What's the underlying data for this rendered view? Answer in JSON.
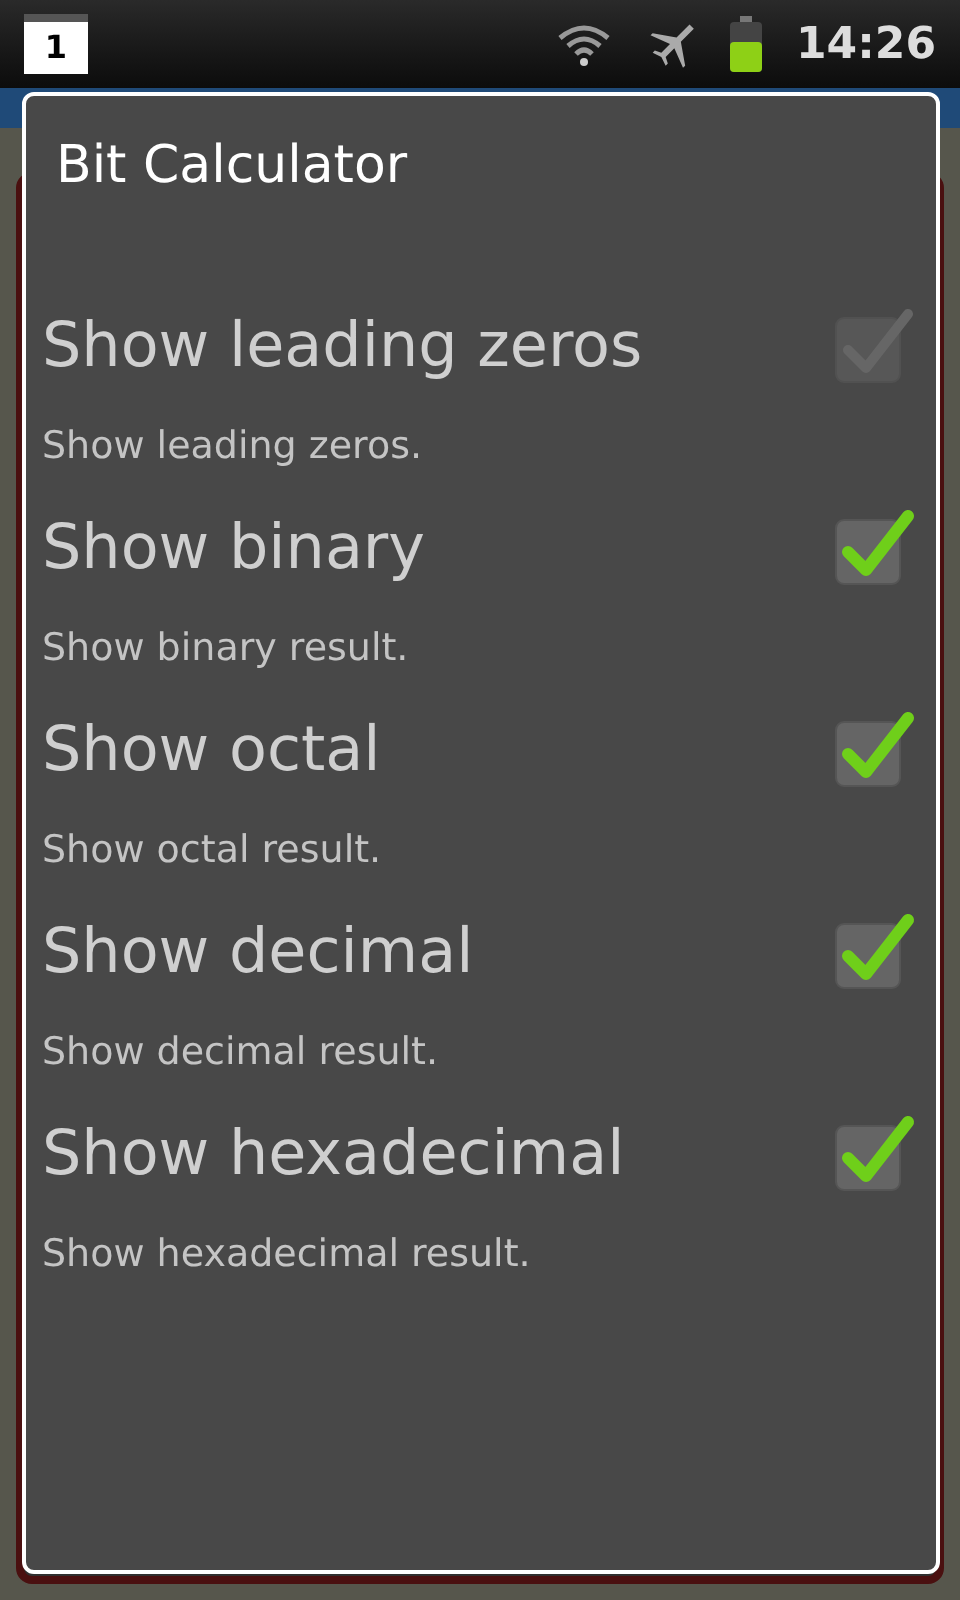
{
  "status_bar": {
    "notification": "1",
    "time": "14:26"
  },
  "dialog": {
    "title": "Bit Calculator",
    "items": [
      {
        "title": "Show leading zeros",
        "summary": "Show leading zeros.",
        "checked": true,
        "disabled": true
      },
      {
        "title": "Show binary",
        "summary": "Show binary result.",
        "checked": true,
        "disabled": false
      },
      {
        "title": "Show octal",
        "summary": "Show octal result.",
        "checked": true,
        "disabled": false
      },
      {
        "title": "Show decimal",
        "summary": "Show decimal result.",
        "checked": true,
        "disabled": false
      },
      {
        "title": "Show hexadecimal",
        "summary": "Show hexadecimal result.",
        "checked": true,
        "disabled": false
      }
    ]
  }
}
